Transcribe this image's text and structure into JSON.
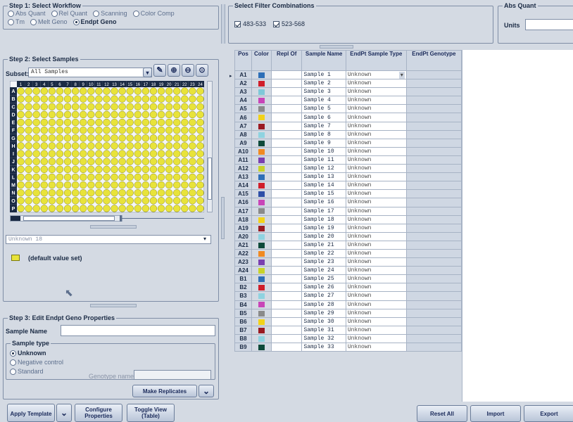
{
  "step1": {
    "title": "Step 1: Select Workflow",
    "options_row1": [
      "Abs Quant",
      "Rel Quant",
      "Scanning",
      "Color Comp"
    ],
    "options_row2": [
      "Tm",
      "Melt Geno",
      "Endpt Geno"
    ],
    "selected": "Endpt Geno"
  },
  "filter": {
    "title": "Select Filter Combinations",
    "items": [
      "483-533",
      "523-568"
    ]
  },
  "abs_quant": {
    "title": "Abs Quant",
    "units_label": "Units",
    "units_value": ""
  },
  "step2": {
    "title": "Step 2: Select Samples",
    "subset_label": "Subset:",
    "subset_value": "All Samples",
    "col_headers": [
      "1",
      "2",
      "3",
      "4",
      "5",
      "6",
      "7",
      "8",
      "9",
      "10",
      "11",
      "12",
      "13",
      "14",
      "15",
      "16",
      "17",
      "18",
      "19",
      "20",
      "21",
      "22",
      "23",
      "24"
    ],
    "row_headers": [
      "A",
      "B",
      "C",
      "D",
      "E",
      "F",
      "G",
      "H",
      "I",
      "J",
      "K",
      "L",
      "M",
      "N",
      "O",
      "P"
    ],
    "combo_value": "Unknown 18",
    "default_value_label": "(default value set)"
  },
  "step3": {
    "title": "Step 3: Edit Endpt Geno Properties",
    "sample_name_label": "Sample Name",
    "sample_name_value": "",
    "sample_type_title": "Sample type",
    "sample_types": [
      "Unknown",
      "Negative control",
      "Standard"
    ],
    "selected_type": "Unknown",
    "genotype_label": "Genotype name",
    "make_replicates": "Make Replicates"
  },
  "table": {
    "headers": [
      "Pos",
      "Color",
      "Repl Of",
      "Sample Name",
      "EndPt Sample Type",
      "EndPt Genotype"
    ],
    "rows": [
      {
        "pos": "A1",
        "color": "#2e6fb7",
        "name": "Sample 1",
        "type": "Unknown"
      },
      {
        "pos": "A2",
        "color": "#d01e2a",
        "name": "Sample 2",
        "type": "Unknown"
      },
      {
        "pos": "A3",
        "color": "#7fc8d8",
        "name": "Sample 3",
        "type": "Unknown"
      },
      {
        "pos": "A4",
        "color": "#c845b8",
        "name": "Sample 4",
        "type": "Unknown"
      },
      {
        "pos": "A5",
        "color": "#8a8a8a",
        "name": "Sample 5",
        "type": "Unknown"
      },
      {
        "pos": "A6",
        "color": "#f2d21a",
        "name": "Sample 6",
        "type": "Unknown"
      },
      {
        "pos": "A7",
        "color": "#9a1a22",
        "name": "Sample 7",
        "type": "Unknown"
      },
      {
        "pos": "A8",
        "color": "#8fd3e0",
        "name": "Sample 8",
        "type": "Unknown"
      },
      {
        "pos": "A9",
        "color": "#0e4a3a",
        "name": "Sample 9",
        "type": "Unknown"
      },
      {
        "pos": "A10",
        "color": "#f08a22",
        "name": "Sample 10",
        "type": "Unknown"
      },
      {
        "pos": "A11",
        "color": "#7a3fb0",
        "name": "Sample 11",
        "type": "Unknown"
      },
      {
        "pos": "A12",
        "color": "#c8d22a",
        "name": "Sample 12",
        "type": "Unknown"
      },
      {
        "pos": "A13",
        "color": "#2e6fb7",
        "name": "Sample 13",
        "type": "Unknown"
      },
      {
        "pos": "A14",
        "color": "#d01e2a",
        "name": "Sample 14",
        "type": "Unknown"
      },
      {
        "pos": "A15",
        "color": "#2e4fa7",
        "name": "Sample 15",
        "type": "Unknown"
      },
      {
        "pos": "A16",
        "color": "#c845b8",
        "name": "Sample 16",
        "type": "Unknown"
      },
      {
        "pos": "A17",
        "color": "#8a8a8a",
        "name": "Sample 17",
        "type": "Unknown"
      },
      {
        "pos": "A18",
        "color": "#f2d21a",
        "name": "Sample 18",
        "type": "Unknown"
      },
      {
        "pos": "A19",
        "color": "#9a1a22",
        "name": "Sample 19",
        "type": "Unknown"
      },
      {
        "pos": "A20",
        "color": "#8fd3e0",
        "name": "Sample 20",
        "type": "Unknown"
      },
      {
        "pos": "A21",
        "color": "#0e4a3a",
        "name": "Sample 21",
        "type": "Unknown"
      },
      {
        "pos": "A22",
        "color": "#f08a22",
        "name": "Sample 22",
        "type": "Unknown"
      },
      {
        "pos": "A23",
        "color": "#7a3fb0",
        "name": "Sample 23",
        "type": "Unknown"
      },
      {
        "pos": "A24",
        "color": "#c8d22a",
        "name": "Sample 24",
        "type": "Unknown"
      },
      {
        "pos": "B1",
        "color": "#2e6fb7",
        "name": "Sample 25",
        "type": "Unknown"
      },
      {
        "pos": "B2",
        "color": "#d01e2a",
        "name": "Sample 26",
        "type": "Unknown"
      },
      {
        "pos": "B3",
        "color": "#8fd3e0",
        "name": "Sample 27",
        "type": "Unknown"
      },
      {
        "pos": "B4",
        "color": "#c845b8",
        "name": "Sample 28",
        "type": "Unknown"
      },
      {
        "pos": "B5",
        "color": "#8a8a8a",
        "name": "Sample 29",
        "type": "Unknown"
      },
      {
        "pos": "B6",
        "color": "#f2d21a",
        "name": "Sample 30",
        "type": "Unknown"
      },
      {
        "pos": "B7",
        "color": "#9a1a22",
        "name": "Sample 31",
        "type": "Unknown"
      },
      {
        "pos": "B8",
        "color": "#8fd3e0",
        "name": "Sample 32",
        "type": "Unknown"
      },
      {
        "pos": "B9",
        "color": "#0e4a3a",
        "name": "Sample 33",
        "type": "Unknown"
      }
    ]
  },
  "bottom": {
    "apply_template": "Apply Template",
    "configure_properties": "Configure Properties",
    "toggle_view": "Toggle View (Table)",
    "reset_all": "Reset All",
    "import": "Import",
    "export": "Export"
  }
}
